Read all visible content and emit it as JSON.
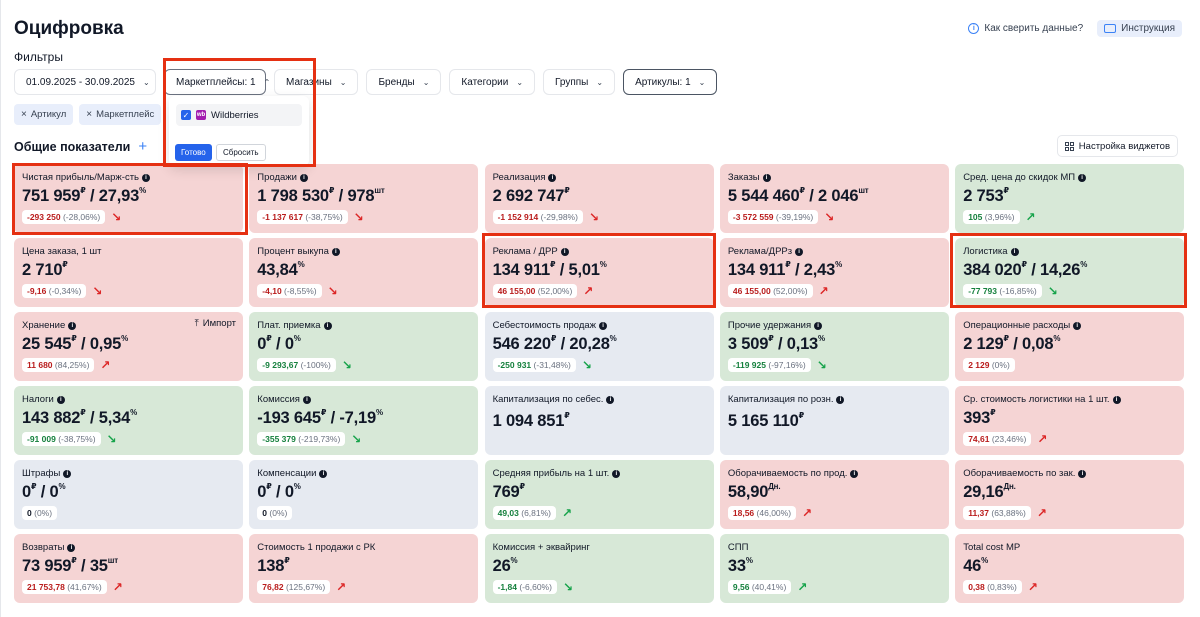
{
  "title": "Оцифровка",
  "header_links": {
    "check": "Как сверить данные?",
    "instruction": "Инструкция"
  },
  "filters_label": "Фильтры",
  "filters": [
    {
      "id": "date",
      "label": "01.09.2025 - 30.09.2025",
      "chevron": "⌄"
    },
    {
      "id": "marketplaces",
      "label": "Маркетплейсы: 1",
      "chevron": "⌃"
    },
    {
      "id": "shops",
      "label": "Магазины",
      "chevron": "⌄"
    },
    {
      "id": "brands",
      "label": "Бренды",
      "chevron": "⌄"
    },
    {
      "id": "categories",
      "label": "Категории",
      "chevron": "⌄"
    },
    {
      "id": "groups",
      "label": "Группы",
      "chevron": "⌄"
    },
    {
      "id": "articles",
      "label": "Артикулы: 1",
      "chevron": "⌄"
    }
  ],
  "chips": [
    {
      "label": "Артикул"
    },
    {
      "label": "Маркетплейс"
    }
  ],
  "dropdown": {
    "item": "Wildberries",
    "logo_text": "wb",
    "done": "Готово",
    "reset": "Сбросить"
  },
  "section_title": "Общие показатели",
  "widget_settings": "Настройка виджетов",
  "import_label": "Импорт",
  "cards": [
    {
      "label": "Чистая прибыль/Марж-сть",
      "info": true,
      "v1": "751 959",
      "u1": "₽",
      "v2": "27,93",
      "u2": "%",
      "delta": "-293 250",
      "pct": "(-28,06%)",
      "sign": "neg",
      "arrow": "↘",
      "arrow_class": "down-red",
      "color": "red"
    },
    {
      "label": "Продажи",
      "info": true,
      "v1": "1 798 530",
      "u1": "₽",
      "v2": "978",
      "u2": "шт",
      "delta": "-1 137 617",
      "pct": "(-38,75%)",
      "sign": "neg",
      "arrow": "↘",
      "arrow_class": "down-red",
      "color": "red"
    },
    {
      "label": "Реализация",
      "info": true,
      "v1": "2 692 747",
      "u1": "₽",
      "v2": "",
      "u2": "",
      "delta": "-1 152 914",
      "pct": "(-29,98%)",
      "sign": "neg",
      "arrow": "↘",
      "arrow_class": "down-red",
      "color": "red"
    },
    {
      "label": "Заказы",
      "info": true,
      "v1": "5 544 460",
      "u1": "₽",
      "v2": "2 046",
      "u2": "шт",
      "delta": "-3 572 559",
      "pct": "(-39,19%)",
      "sign": "neg",
      "arrow": "↘",
      "arrow_class": "down-red",
      "color": "red"
    },
    {
      "label": "Сред. цена до скидок МП",
      "info": true,
      "v1": "2 753",
      "u1": "₽",
      "v2": "",
      "u2": "",
      "delta": "105",
      "pct": "(3,96%)",
      "sign": "pos",
      "arrow": "↗",
      "arrow_class": "up-green",
      "color": "green"
    },
    {
      "label": "Цена заказа, 1 шт",
      "info": false,
      "v1": "2 710",
      "u1": "₽",
      "v2": "",
      "u2": "",
      "delta": "-9,16",
      "pct": "(-0,34%)",
      "sign": "neg",
      "arrow": "↘",
      "arrow_class": "down-red",
      "color": "red"
    },
    {
      "label": "Процент выкупа",
      "info": true,
      "v1": "43,84",
      "u1": "%",
      "v2": "",
      "u2": "",
      "delta": "-4,10",
      "pct": "(-8,55%)",
      "sign": "neg",
      "arrow": "↘",
      "arrow_class": "down-red",
      "color": "red"
    },
    {
      "label": "Реклама / ДРР",
      "info": true,
      "v1": "134 911",
      "u1": "₽",
      "v2": "5,01",
      "u2": "%",
      "delta": "46 155,00",
      "pct": "(52,00%)",
      "sign": "neg",
      "arrow": "↗",
      "arrow_class": "up-red",
      "color": "red"
    },
    {
      "label": "Реклама/ДРРз",
      "info": true,
      "v1": "134 911",
      "u1": "₽",
      "v2": "2,43",
      "u2": "%",
      "delta": "46 155,00",
      "pct": "(52,00%)",
      "sign": "neg",
      "arrow": "↗",
      "arrow_class": "up-red",
      "color": "red"
    },
    {
      "label": "Логистика",
      "info": true,
      "v1": "384 020",
      "u1": "₽",
      "v2": "14,26",
      "u2": "%",
      "delta": "-77 793",
      "pct": "(-16,85%)",
      "sign": "pos",
      "arrow": "↘",
      "arrow_class": "down-green",
      "color": "green"
    },
    {
      "label": "Хранение",
      "info": true,
      "v1": "25 545",
      "u1": "₽",
      "v2": "0,95",
      "u2": "%",
      "delta": "11 680",
      "pct": "(84,25%)",
      "sign": "neg",
      "arrow": "↗",
      "arrow_class": "up-red",
      "color": "red",
      "import": true
    },
    {
      "label": "Плат. приемка",
      "info": true,
      "v1": "0",
      "u1": "₽",
      "v2": "0",
      "u2": "%",
      "delta": "-9 293,67",
      "pct": "(-100%)",
      "sign": "pos",
      "arrow": "↘",
      "arrow_class": "down-green",
      "color": "green"
    },
    {
      "label": "Себестоимость продаж",
      "info": true,
      "v1": "546 220",
      "u1": "₽",
      "v2": "20,28",
      "u2": "%",
      "delta": "-250 931",
      "pct": "(-31,48%)",
      "sign": "pos",
      "arrow": "↘",
      "arrow_class": "down-green",
      "color": "gray"
    },
    {
      "label": "Прочие удержания",
      "info": true,
      "v1": "3 509",
      "u1": "₽",
      "v2": "0,13",
      "u2": "%",
      "delta": "-119 925",
      "pct": "(-97,16%)",
      "sign": "pos",
      "arrow": "↘",
      "arrow_class": "down-green",
      "color": "green"
    },
    {
      "label": "Операционные расходы",
      "info": true,
      "v1": "2 129",
      "u1": "₽",
      "v2": "0,08",
      "u2": "%",
      "delta": "2 129",
      "pct": "(0%)",
      "sign": "neg",
      "arrow": "",
      "arrow_class": "",
      "color": "red"
    },
    {
      "label": "Налоги",
      "info": true,
      "v1": "143 882",
      "u1": "₽",
      "v2": "5,34",
      "u2": "%",
      "delta": "-91 009",
      "pct": "(-38,75%)",
      "sign": "pos",
      "arrow": "↘",
      "arrow_class": "down-green",
      "color": "green"
    },
    {
      "label": "Комиссия",
      "info": true,
      "v1": "-193 645",
      "u1": "₽",
      "v2": "-7,19",
      "u2": "%",
      "delta": "-355 379",
      "pct": "(-219,73%)",
      "sign": "pos",
      "arrow": "↘",
      "arrow_class": "down-green",
      "color": "green"
    },
    {
      "label": "Капитализация по себес.",
      "info": true,
      "v1": "1 094 851",
      "u1": "₽",
      "v2": "",
      "u2": "",
      "delta": "",
      "pct": "",
      "sign": "neu",
      "arrow": "",
      "arrow_class": "",
      "color": "gray",
      "tall": true
    },
    {
      "label": "Капитализация по розн.",
      "info": true,
      "v1": "5 165 110",
      "u1": "₽",
      "v2": "",
      "u2": "",
      "delta": "",
      "pct": "",
      "sign": "neu",
      "arrow": "",
      "arrow_class": "",
      "color": "gray",
      "tall": true
    },
    {
      "label": "Ср. стоимость логистики на 1 шт.",
      "info": true,
      "v1": "393",
      "u1": "₽",
      "v2": "",
      "u2": "",
      "delta": "74,61",
      "pct": "(23,46%)",
      "sign": "neg",
      "arrow": "↗",
      "arrow_class": "up-red",
      "color": "red"
    },
    {
      "label": "Штрафы",
      "info": true,
      "v1": "0",
      "u1": "₽",
      "v2": "0",
      "u2": "%",
      "delta": "0",
      "pct": "(0%)",
      "sign": "neu",
      "arrow": "",
      "arrow_class": "",
      "color": "gray"
    },
    {
      "label": "Компенсации",
      "info": true,
      "v1": "0",
      "u1": "₽",
      "v2": "0",
      "u2": "%",
      "delta": "0",
      "pct": "(0%)",
      "sign": "neu",
      "arrow": "",
      "arrow_class": "",
      "color": "gray"
    },
    {
      "label": "Средняя прибыль на 1 шт.",
      "info": true,
      "v1": "769",
      "u1": "₽",
      "v2": "",
      "u2": "",
      "delta": "49,03",
      "pct": "(6,81%)",
      "sign": "pos",
      "arrow": "↗",
      "arrow_class": "up-green",
      "color": "green"
    },
    {
      "label": "Оборачиваемость по прод.",
      "info": true,
      "v1": "58,90",
      "u1": "Дн.",
      "v2": "",
      "u2": "",
      "delta": "18,56",
      "pct": "(46,00%)",
      "sign": "neg",
      "arrow": "↗",
      "arrow_class": "up-red",
      "color": "red"
    },
    {
      "label": "Оборачиваемость по зак.",
      "info": true,
      "v1": "29,16",
      "u1": "Дн.",
      "v2": "",
      "u2": "",
      "delta": "11,37",
      "pct": "(63,88%)",
      "sign": "neg",
      "arrow": "↗",
      "arrow_class": "up-red",
      "color": "red"
    },
    {
      "label": "Возвраты",
      "info": true,
      "v1": "73 959",
      "u1": "₽",
      "v2": "35",
      "u2": "шт",
      "delta": "21 753,78",
      "pct": "(41,67%)",
      "sign": "neg",
      "arrow": "↗",
      "arrow_class": "up-red",
      "color": "red"
    },
    {
      "label": "Стоимость 1 продажи с РК",
      "info": false,
      "v1": "138",
      "u1": "₽",
      "v2": "",
      "u2": "",
      "delta": "76,82",
      "pct": "(125,67%)",
      "sign": "neg",
      "arrow": "↗",
      "arrow_class": "up-red",
      "color": "red"
    },
    {
      "label": "Комиссия + эквайринг",
      "info": false,
      "v1": "26",
      "u1": "%",
      "v2": "",
      "u2": "",
      "delta": "-1,84",
      "pct": "(-6,60%)",
      "sign": "pos",
      "arrow": "↘",
      "arrow_class": "down-green",
      "color": "green"
    },
    {
      "label": "СПП",
      "info": false,
      "v1": "33",
      "u1": "%",
      "v2": "",
      "u2": "",
      "delta": "9,56",
      "pct": "(40,41%)",
      "sign": "pos",
      "arrow": "↗",
      "arrow_class": "up-green",
      "color": "green"
    },
    {
      "label": "Total cost MP",
      "info": false,
      "v1": "46",
      "u1": "%",
      "v2": "",
      "u2": "",
      "delta": "0,38",
      "pct": "(0,83%)",
      "sign": "neg",
      "arrow": "↗",
      "arrow_class": "up-red",
      "color": "red"
    }
  ]
}
